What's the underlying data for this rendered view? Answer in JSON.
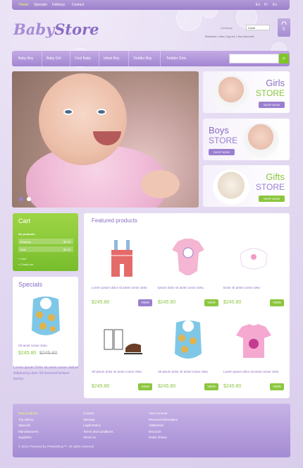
{
  "top_nav": {
    "items": [
      "Home",
      "Specials",
      "Delivery",
      "Contact"
    ],
    "languages": [
      "En",
      "Fr",
      "Es"
    ]
  },
  "logo": {
    "part1": "Baby",
    "part2": "Store"
  },
  "currency": {
    "label": "Currency:",
    "value": "Dollar"
  },
  "user": {
    "text": "Welcome, User | log out | Your Account"
  },
  "cart_icon": {
    "count": "0"
  },
  "main_nav": {
    "items": [
      "Baby Boy",
      "Baby Girl",
      "Cool Baby",
      "Infant Boy",
      "Toddler Boy",
      "Toddler Girls"
    ]
  },
  "search": {
    "placeholder": ""
  },
  "banners": [
    {
      "title": "Girls",
      "subtitle": "STORE",
      "button": "SHOP NOW!"
    },
    {
      "title": "Boys",
      "subtitle": "STORE",
      "button": "SHOP NOW!"
    },
    {
      "title": "Gifts",
      "subtitle": "STORE",
      "button": "SHOP NOW!"
    }
  ],
  "cart": {
    "title": "Cart",
    "empty": "No products",
    "rows": [
      {
        "label": "Shipping",
        "value": "$0.00"
      },
      {
        "label": "Total",
        "value": "$0.00"
      }
    ],
    "links": [
      "» Cart",
      "» Check out"
    ]
  },
  "specials": {
    "title": "Specials",
    "product_name": "Sit amet conse ctetu",
    "price": "$245.80",
    "old_price": "$245.80"
  },
  "tags": "Lorem ipsum Dolor sit amet conse ctetuer Adipiscing ulum Sit eiusmod tempor lacinia",
  "featured": {
    "title": "Featured products",
    "products": [
      {
        "name": "Lorem ipsum dolor sit amet conse ctetu",
        "price": "$245.80",
        "view": "VIEW"
      },
      {
        "name": "Ipsum dolor sit amet conse ctetu",
        "price": "$245.80",
        "view": "VIEW"
      },
      {
        "name": "Dolor sit amet conse ctetu",
        "price": "$245.80",
        "view": "VIEW"
      },
      {
        "name": "Sit ipsum dolor sit amet conse ctetu",
        "price": "$245.80",
        "view": "VIEW"
      },
      {
        "name": "Sit ipsum dolor sit amet conse ctetu",
        "price": "$245.80",
        "view": "VIEW"
      },
      {
        "name": "Lorem ipsum dolor sit amet conse ctetu",
        "price": "$245.80",
        "view": "VIEW"
      }
    ]
  },
  "footer": {
    "col1": [
      "New products",
      "Top sellers",
      "Specials",
      "Manufacturers",
      "Suppliers"
    ],
    "col2": [
      "Contact",
      "Sitemap",
      "Legal Notice",
      "Terms and conditions",
      "About us"
    ],
    "col3": [
      "Your Account",
      "Personal information",
      "Addresses",
      "Discount",
      "Order history"
    ],
    "copyright": "© 2012 Powered by PrestaShop™. All rights reserved"
  }
}
